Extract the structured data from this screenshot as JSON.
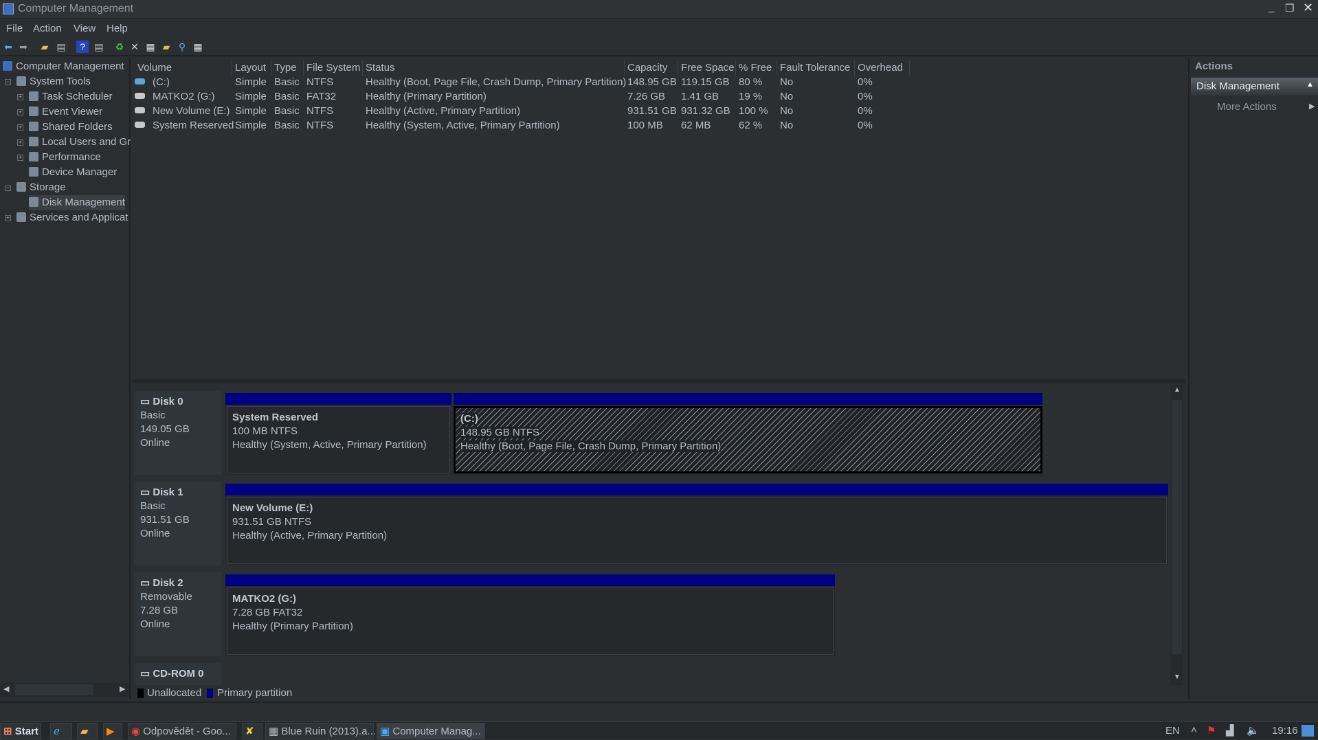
{
  "window": {
    "title": "Computer Management"
  },
  "menu": [
    "File",
    "Action",
    "View",
    "Help"
  ],
  "toolbar_icons": [
    "back-icon",
    "forward-icon",
    "up-folder-icon",
    "show-hide-console-tree-icon",
    "help-icon",
    "show-hide-action-pane-icon",
    "refresh-icon",
    "delete-icon",
    "properties-icon",
    "open-icon",
    "search-icon",
    "settings-icon"
  ],
  "tree": {
    "root": "Computer Management",
    "items": [
      {
        "label": "System Tools",
        "level": 1,
        "exp": "−"
      },
      {
        "label": "Task Scheduler",
        "level": 2,
        "exp": "+"
      },
      {
        "label": "Event Viewer",
        "level": 2,
        "exp": "+"
      },
      {
        "label": "Shared Folders",
        "level": 2,
        "exp": "+"
      },
      {
        "label": "Local Users and Gr",
        "level": 2,
        "exp": "+"
      },
      {
        "label": "Performance",
        "level": 2,
        "exp": "+"
      },
      {
        "label": "Device Manager",
        "level": 2,
        "exp": ""
      },
      {
        "label": "Storage",
        "level": 1,
        "exp": "−"
      },
      {
        "label": "Disk Management",
        "level": 2,
        "exp": ""
      },
      {
        "label": "Services and Applicat",
        "level": 1,
        "exp": "+"
      }
    ]
  },
  "volumes": {
    "columns": [
      "Volume",
      "Layout",
      "Type",
      "File System",
      "Status",
      "Capacity",
      "Free Space",
      "% Free",
      "Fault Tolerance",
      "Overhead"
    ],
    "rows": [
      [
        "(C:)",
        "Simple",
        "Basic",
        "NTFS",
        "Healthy (Boot, Page File, Crash Dump, Primary Partition)",
        "148.95 GB",
        "119.15 GB",
        "80 %",
        "No",
        "0%"
      ],
      [
        "MATKO2 (G:)",
        "Simple",
        "Basic",
        "FAT32",
        "Healthy (Primary Partition)",
        "7.26 GB",
        "1.41 GB",
        "19 %",
        "No",
        "0%"
      ],
      [
        "New Volume (E:)",
        "Simple",
        "Basic",
        "NTFS",
        "Healthy (Active, Primary Partition)",
        "931.51 GB",
        "931.32 GB",
        "100 %",
        "No",
        "0%"
      ],
      [
        "System Reserved",
        "Simple",
        "Basic",
        "NTFS",
        "Healthy (System, Active, Primary Partition)",
        "100 MB",
        "62 MB",
        "62 %",
        "No",
        "0%"
      ]
    ]
  },
  "disks": [
    {
      "name": "Disk 0",
      "type": "Basic",
      "size": "149.05 GB",
      "state": "Online",
      "partitions": [
        {
          "name": "System Reserved",
          "size": "100 MB NTFS",
          "status": "Healthy (System, Active, Primary Partition)"
        },
        {
          "name": "(C:)",
          "size": "148.95 GB NTFS",
          "status": "Healthy (Boot, Page File, Crash Dump, Primary Partition)"
        }
      ]
    },
    {
      "name": "Disk 1",
      "type": "Basic",
      "size": "931.51 GB",
      "state": "Online",
      "partitions": [
        {
          "name": "New Volume  (E:)",
          "size": "931.51 GB NTFS",
          "status": "Healthy (Active, Primary Partition)"
        }
      ]
    },
    {
      "name": "Disk 2",
      "type": "Removable",
      "size": "7.28 GB",
      "state": "Online",
      "partitions": [
        {
          "name": "MATKO2  (G:)",
          "size": "7.28 GB FAT32",
          "status": "Healthy (Primary Partition)"
        }
      ]
    },
    {
      "name": "CD-ROM 0"
    }
  ],
  "legend": {
    "unallocated": "Unallocated",
    "primary": "Primary partition",
    "unallocated_color": "#000000",
    "primary_color": "#000080"
  },
  "actions": {
    "header": "Actions",
    "section": "Disk Management",
    "more": "More Actions"
  },
  "taskbar": {
    "start": "Start",
    "tasks": [
      "Odpovědět - Goo...",
      "Blue Ruin (2013).a...",
      "Computer Manag..."
    ],
    "lang": "EN",
    "time": "19:16"
  }
}
